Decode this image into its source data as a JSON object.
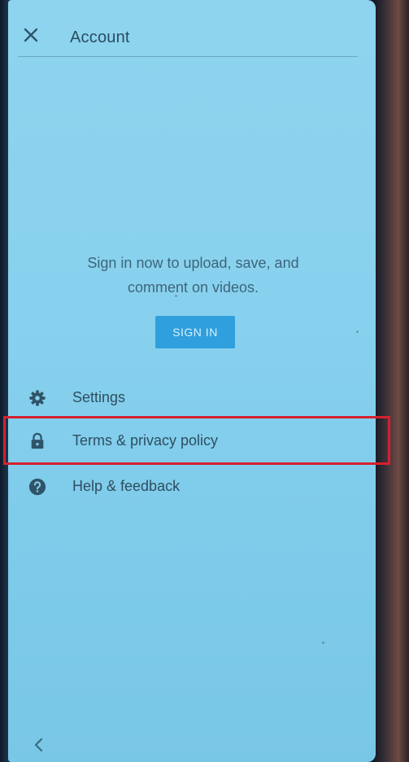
{
  "header": {
    "title": "Account",
    "close_icon": "close-icon"
  },
  "signin_prompt": {
    "message_line1": "Sign in now to upload, save, and",
    "message_line2": "comment on videos.",
    "button_label": "SIGN IN"
  },
  "menu": {
    "items": [
      {
        "label": "Settings",
        "icon": "gear-icon"
      },
      {
        "label": "Terms & privacy policy",
        "icon": "lock-icon"
      },
      {
        "label": "Help & feedback",
        "icon": "help-icon"
      }
    ]
  },
  "nav": {
    "back_icon": "back-chevron-icon"
  },
  "colors": {
    "screen_background": "#88d1ee",
    "button_background": "#2f9fdd",
    "highlight_border": "#d6202e",
    "text": "#2e4e60"
  }
}
